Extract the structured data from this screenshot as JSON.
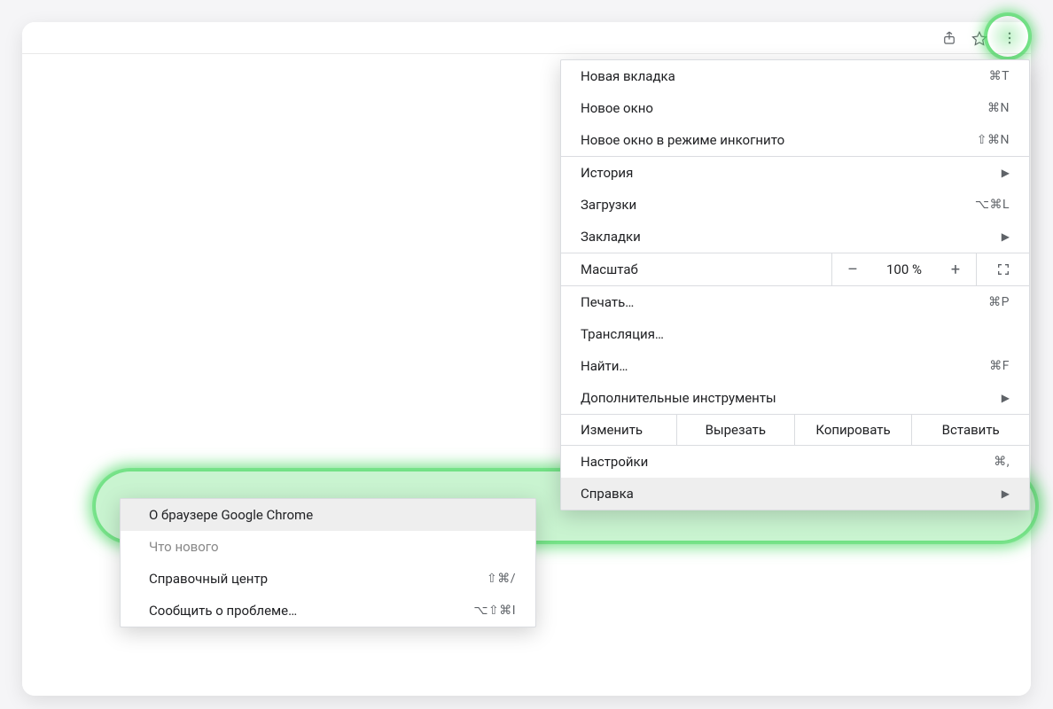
{
  "menu": {
    "new_tab": {
      "label": "Новая вкладка",
      "shortcut": "⌘T"
    },
    "new_window": {
      "label": "Новое окно",
      "shortcut": "⌘N"
    },
    "incognito": {
      "label": "Новое окно в режиме инкогнито",
      "shortcut": "⇧⌘N"
    },
    "history": {
      "label": "История"
    },
    "downloads": {
      "label": "Загрузки",
      "shortcut": "⌥⌘L"
    },
    "bookmarks": {
      "label": "Закладки"
    },
    "zoom": {
      "label": "Масштаб",
      "minus": "–",
      "value": "100 %",
      "plus": "+"
    },
    "print": {
      "label": "Печать…",
      "shortcut": "⌘P"
    },
    "cast": {
      "label": "Трансляция…"
    },
    "find": {
      "label": "Найти…",
      "shortcut": "⌘F"
    },
    "more_tools": {
      "label": "Дополнительные инструменты"
    },
    "edit": {
      "label": "Изменить",
      "cut": "Вырезать",
      "copy": "Копировать",
      "paste": "Вставить"
    },
    "settings": {
      "label": "Настройки",
      "shortcut": "⌘,"
    },
    "help": {
      "label": "Справка"
    }
  },
  "help_menu": {
    "about": {
      "label": "О браузере Google Chrome"
    },
    "whats_new": {
      "label": "Что нового"
    },
    "help_center": {
      "label": "Справочный центр",
      "shortcut": "⇧⌘/"
    },
    "report": {
      "label": "Сообщить о проблеме…",
      "shortcut": "⌥⇧⌘I"
    }
  },
  "chevron": "▶"
}
